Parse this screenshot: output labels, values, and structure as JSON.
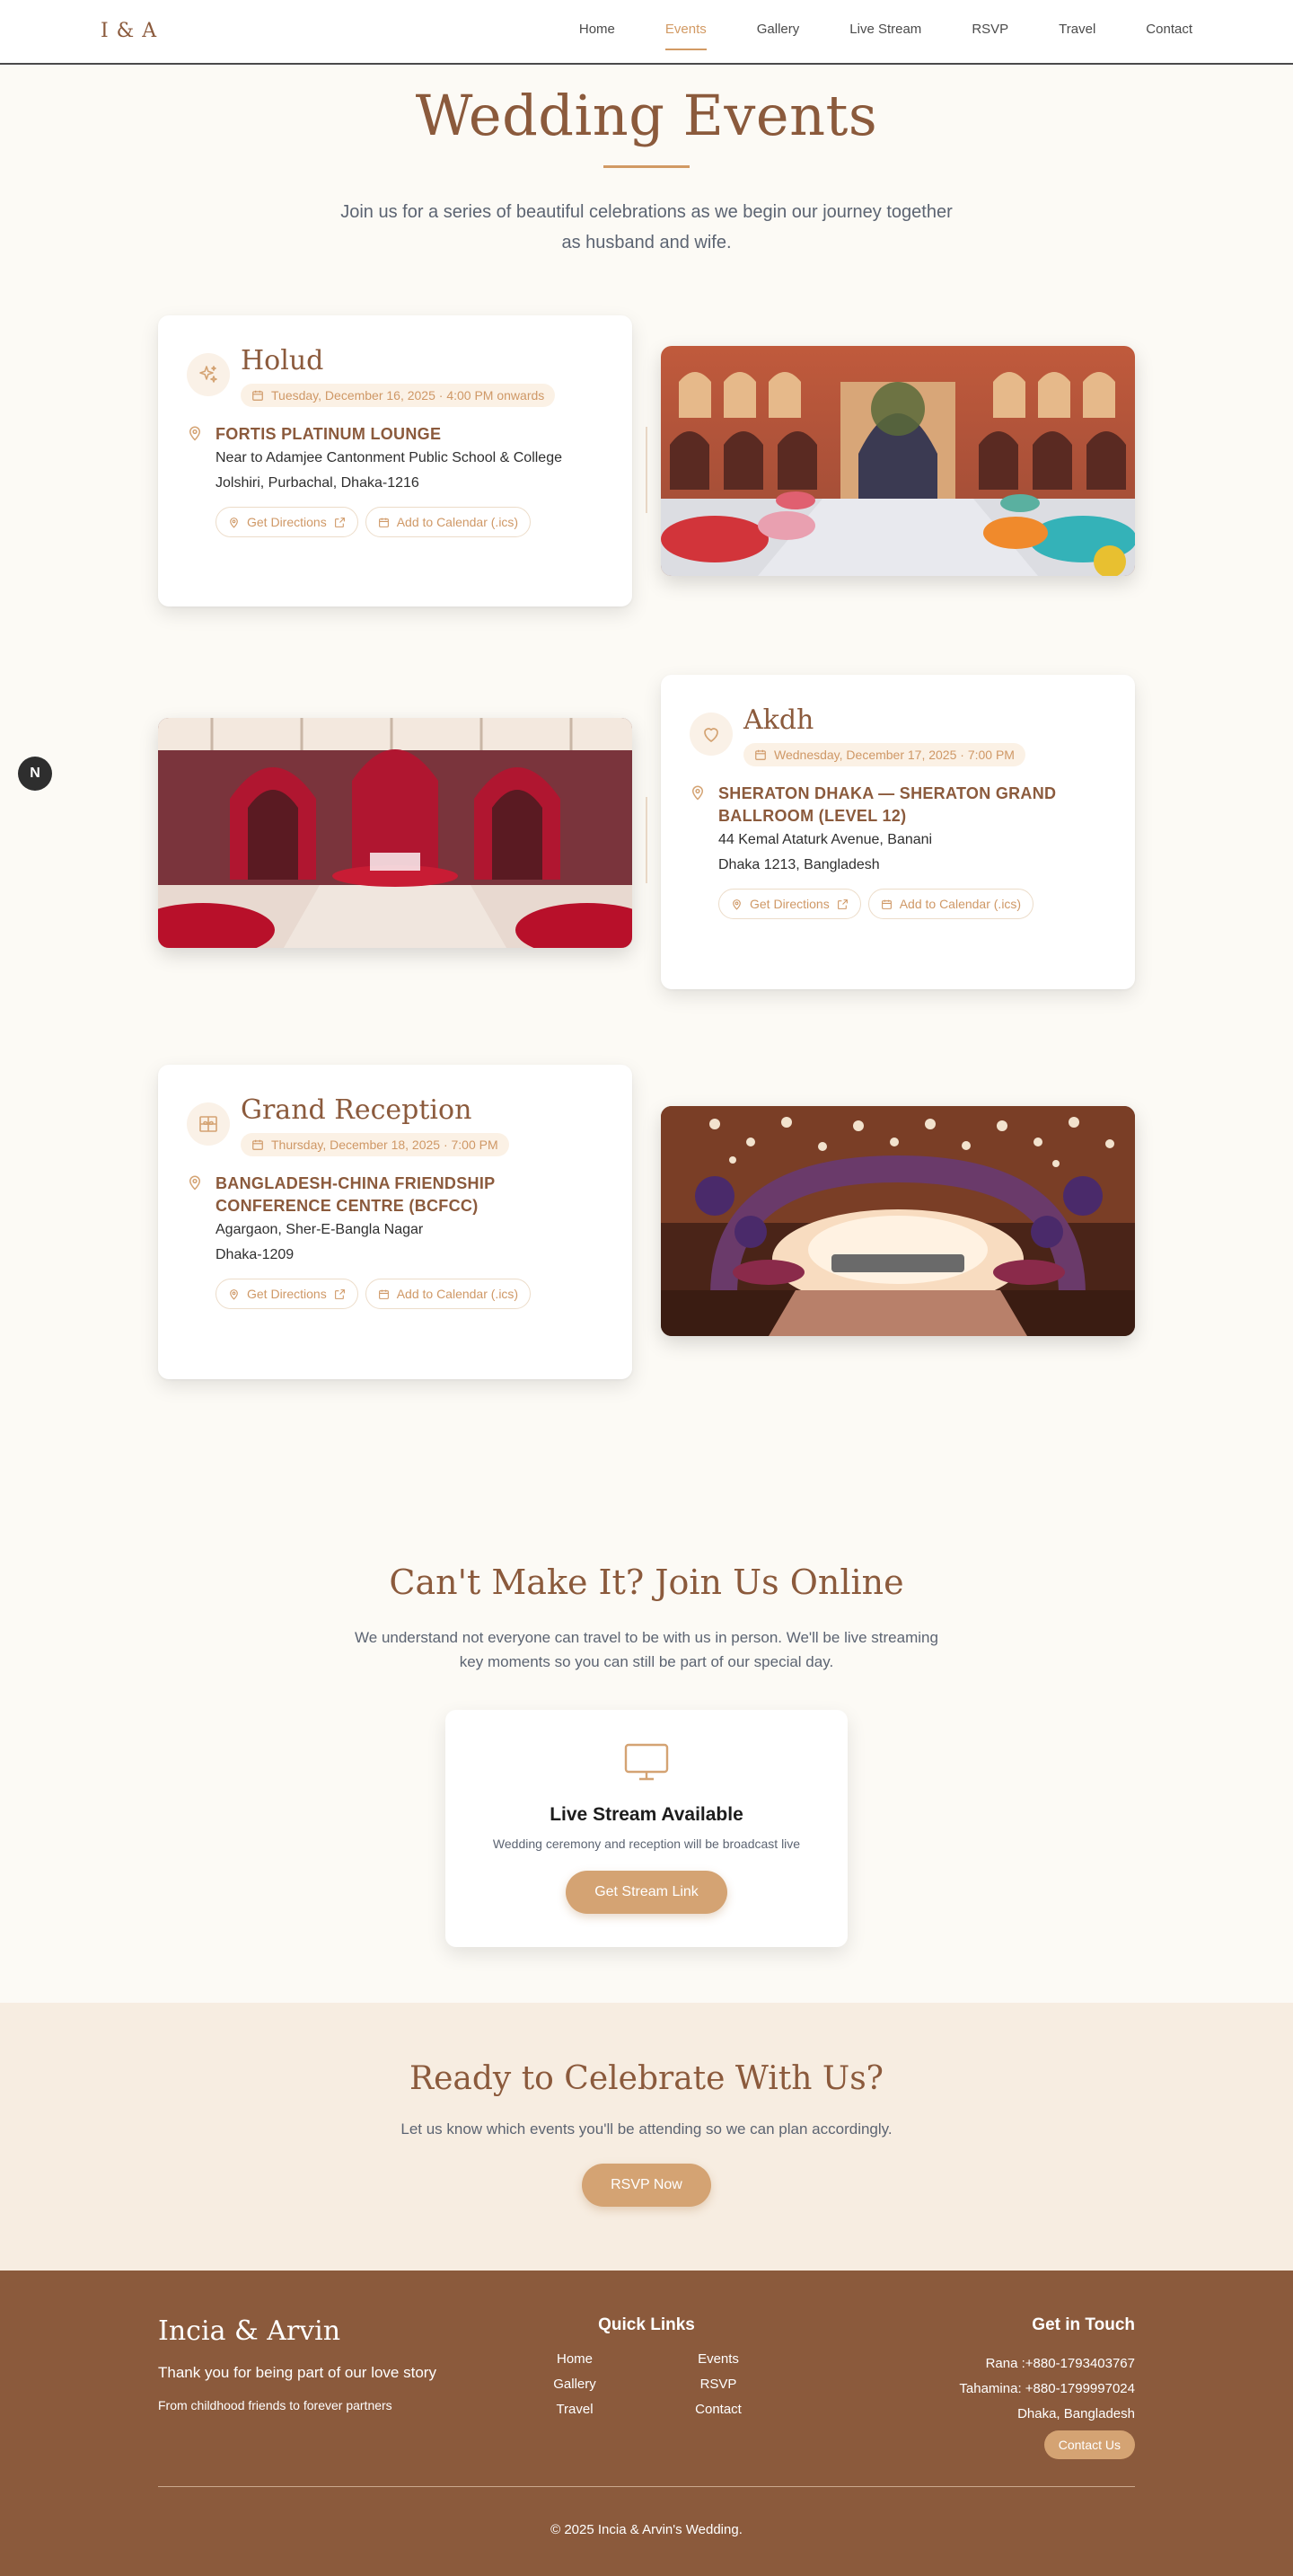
{
  "header": {
    "logo": "I & A",
    "nav": [
      "Home",
      "Events",
      "Gallery",
      "Live Stream",
      "RSVP",
      "Travel",
      "Contact"
    ],
    "active": "Events"
  },
  "hero": {
    "title": "Wedding Events",
    "subtitle": "Join us for a series of beautiful celebrations as we begin our journey together as husband and wife."
  },
  "events": [
    {
      "title": "Holud",
      "date": "Tuesday, December 16, 2025 · 4:00 PM onwards",
      "venue": "FORTIS PLATINUM LOUNGE",
      "address": [
        "Near to Adamjee Cantonment Public School & College",
        "Jolshiri, Purbachal, Dhaka-1216"
      ],
      "icon": "sparkles-icon"
    },
    {
      "title": "Akdh",
      "date": "Wednesday, December 17, 2025 · 7:00 PM",
      "venue": "SHERATON DHAKA — SHERATON GRAND BALLROOM (LEVEL 12)",
      "address": [
        "44 Kemal Ataturk Avenue, Banani",
        "Dhaka 1213, Bangladesh"
      ],
      "icon": "heart-icon"
    },
    {
      "title": "Grand Reception",
      "date": "Thursday, December 18, 2025 · 7:00 PM",
      "venue": "BANGLADESH-CHINA FRIENDSHIP CONFERENCE CENTRE (BCFCC)",
      "address": [
        "Agargaon, Sher-E-Bangla Nagar",
        "Dhaka-1209"
      ],
      "icon": "gift-icon"
    }
  ],
  "event_actions": {
    "directions": "Get Directions",
    "calendar": "Add to Calendar (.ics)"
  },
  "fab": {
    "label": "N"
  },
  "live": {
    "title": "Can't Make It? Join Us Online",
    "subtitle": "We understand not everyone can travel to be with us in person. We'll be live streaming key moments so you can still be part of our special day.",
    "card_title": "Live Stream Available",
    "card_text": "Wedding ceremony and reception will be broadcast live",
    "button": "Get Stream Link"
  },
  "rsvp": {
    "title": "Ready to Celebrate With Us?",
    "subtitle": "Let us know which events you'll be attending so we can plan accordingly.",
    "button": "RSVP Now"
  },
  "footer": {
    "brand": "Incia & Arvin",
    "thanks": "Thank you for being part of our love story",
    "from": "From childhood friends to forever partners",
    "quick_links_title": "Quick Links",
    "quick_links": [
      "Home",
      "Events",
      "Gallery",
      "RSVP",
      "Travel",
      "Contact"
    ],
    "touch_title": "Get in Touch",
    "contacts": [
      "Rana :+880-1793403767",
      "Tahamina: +880-1799997024",
      "Dhaka, Bangladesh"
    ],
    "contact_button": "Contact Us",
    "copyright": "© 2025 Incia & Arvin's Wedding."
  },
  "colors": {
    "brand": "#8b5a3c",
    "accent": "#d4a373",
    "background": "#fcfaf5"
  }
}
